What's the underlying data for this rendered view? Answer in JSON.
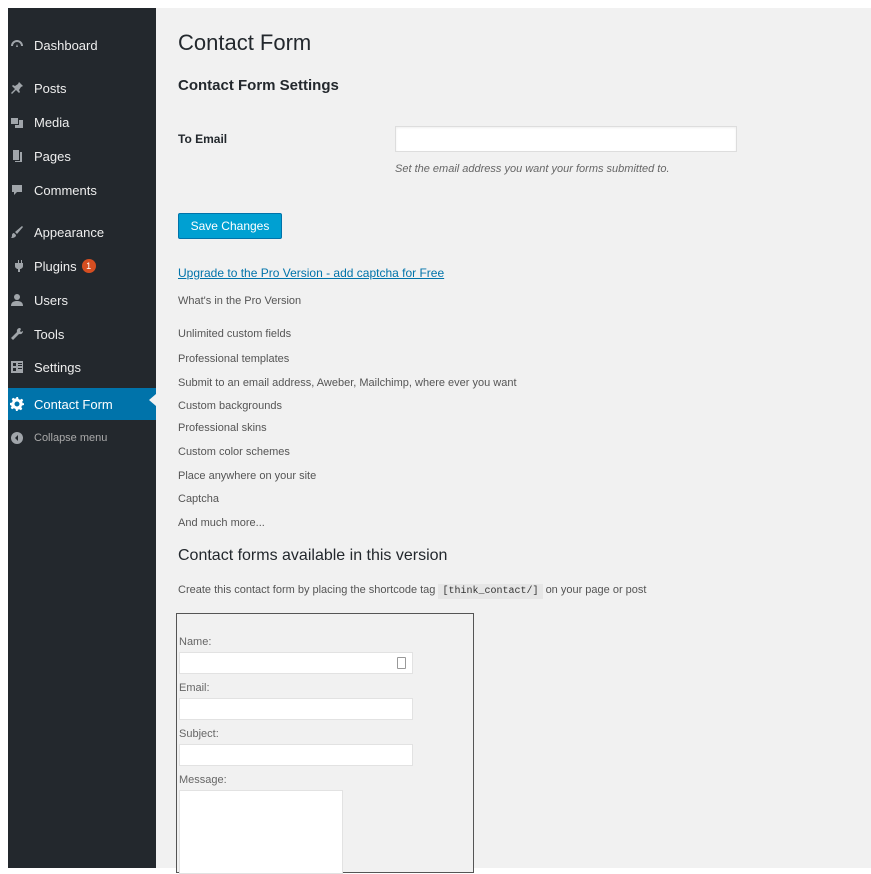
{
  "sidebar": {
    "items": [
      {
        "label": "Dashboard",
        "icon": "dashboard-icon"
      },
      {
        "label": "Posts",
        "icon": "pin-icon"
      },
      {
        "label": "Media",
        "icon": "media-icon"
      },
      {
        "label": "Pages",
        "icon": "pages-icon"
      },
      {
        "label": "Comments",
        "icon": "comment-icon"
      },
      {
        "label": "Appearance",
        "icon": "brush-icon"
      },
      {
        "label": "Plugins",
        "icon": "plugin-icon",
        "badge": "1"
      },
      {
        "label": "Users",
        "icon": "users-icon"
      },
      {
        "label": "Tools",
        "icon": "wrench-icon"
      },
      {
        "label": "Settings",
        "icon": "settings-icon"
      },
      {
        "label": "Contact Form",
        "icon": "gear-icon",
        "active": true
      },
      {
        "label": "Collapse menu",
        "icon": "collapse-icon"
      }
    ]
  },
  "page": {
    "title": "Contact Form",
    "settings_heading": "Contact Form Settings",
    "to_email_label": "To Email",
    "to_email_value": "",
    "to_email_description": "Set the email address you want your forms submitted to.",
    "save_button": "Save Changes",
    "upgrade_link": "Upgrade to the Pro Version - add captcha for Free",
    "pro_heading": "What's in the Pro Version",
    "pro_features": [
      "Unlimited custom fields",
      "Professional templates",
      "Submit to an email address, Aweber, Mailchimp, where ever you want",
      "Custom backgrounds",
      "Professional skins",
      "Custom color schemes",
      "Place anywhere on your site",
      "Captcha",
      "And much more..."
    ],
    "available_heading": "Contact forms available in this version",
    "shortcode_prefix": "Create this contact form by placing the shortcode tag",
    "shortcode_tag": "[think_contact/]",
    "shortcode_suffix": "on your page or post"
  },
  "preview": {
    "name_label": "Name:",
    "email_label": "Email:",
    "subject_label": "Subject:",
    "message_label": "Message:"
  }
}
